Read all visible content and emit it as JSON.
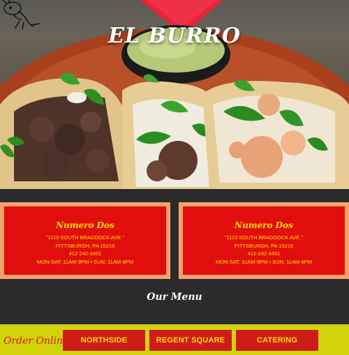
{
  "brand": {
    "name": "EL BURRO"
  },
  "locations": [
    {
      "name": "Numero Dos",
      "address": "\"1113 SOUTH BRADDOCK AVE.\"",
      "city": "PITTSBURGH, PA 15218",
      "phone": "412-242-3451",
      "hours": "MON-SAT: 11AM-9PM • SUN: 11AM-8PM"
    },
    {
      "name": "Numero Dos",
      "address": "\"1113 SOUTH BRADDOCK AVE.\"",
      "city": "PITTSBURGH, PA 15218",
      "phone": "412-242-3451",
      "hours": "MON-SAT: 11AM-9PM • SUN: 11AM-8PM"
    }
  ],
  "menu": {
    "heading": "Our Menu"
  },
  "order": {
    "label": "Order Online",
    "buttons": [
      "NORTHSIDE",
      "REGENT SQUARE",
      "CATERING"
    ]
  },
  "colors": {
    "card_red": "#e20e0e",
    "card_border": "#f4a36c",
    "card_text": "#ffe000",
    "order_bar": "#d2d20a",
    "button_red": "#d01b1b",
    "page_bg": "#2b2b2b"
  },
  "icons": {
    "mascot": "donkey-mascot-icon",
    "hero": "tacos-photo"
  }
}
